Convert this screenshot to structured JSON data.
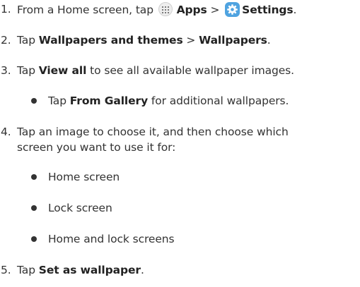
{
  "steps": [
    {
      "number": "1.",
      "pre": "From a Home screen, tap",
      "icon1": "apps-icon",
      "b1": "Apps",
      "sep": ">",
      "icon2": "settings-icon",
      "b2": "Settings",
      "post": "."
    },
    {
      "number": "2.",
      "pre": "Tap",
      "b1": "Wallpapers and themes",
      "sep": ">",
      "b2": "Wallpapers",
      "post": "."
    },
    {
      "number": "3.",
      "pre": "Tap",
      "b1": "View all",
      "post": "to see all available wallpaper images.",
      "sub": {
        "pre": "Tap",
        "b1": "From Gallery",
        "post": "for additional wallpapers."
      }
    },
    {
      "number": "4.",
      "line1": "Tap an image to choose it, and then choose which",
      "line2": "screen you want to use it for:",
      "options": [
        "Home screen",
        "Lock screen",
        "Home and lock screens"
      ]
    },
    {
      "number": "5.",
      "pre": "Tap",
      "b1": "Set as wallpaper",
      "post": "."
    }
  ],
  "colors": {
    "text": "#333333",
    "settings_icon": "#4fa3e0"
  }
}
